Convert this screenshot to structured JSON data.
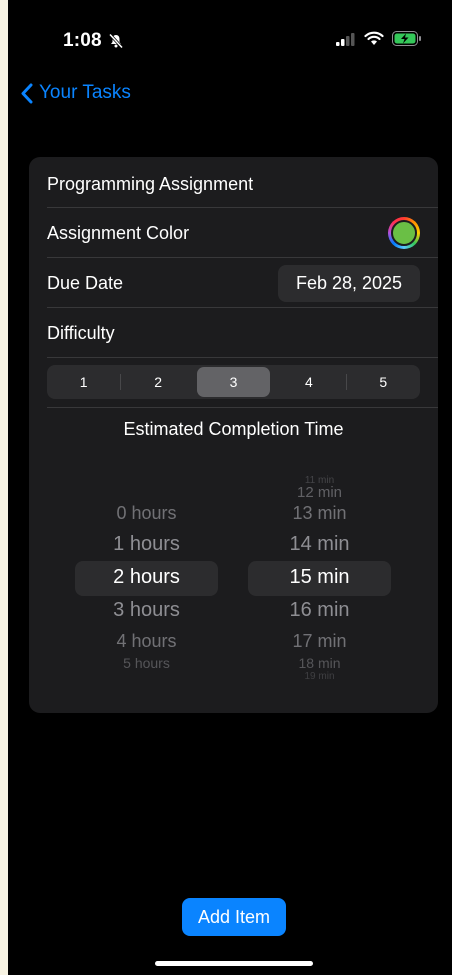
{
  "status": {
    "time": "1:08"
  },
  "nav": {
    "back_label": "Your Tasks"
  },
  "form": {
    "name_value": "Programming Assignment",
    "color_label": "Assignment Color",
    "color_value": "#6abf45",
    "due_label": "Due Date",
    "due_value": "Feb 28, 2025",
    "difficulty_label": "Difficulty",
    "difficulty_options": [
      "1",
      "2",
      "3",
      "4",
      "5"
    ],
    "difficulty_selected": "3",
    "estimate_title": "Estimated Completion Time"
  },
  "picker": {
    "hours": [
      "0 hours",
      "1 hours",
      "2 hours",
      "3 hours",
      "4 hours",
      "5 hours"
    ],
    "hours_selected": "2 hours",
    "minutes": [
      "11 min",
      "12 min",
      "13 min",
      "14 min",
      "15 min",
      "16 min",
      "17 min",
      "18 min",
      "19 min"
    ],
    "minutes_selected": "15 min"
  },
  "actions": {
    "add_label": "Add Item"
  },
  "colors": {
    "accent": "#0a84ff",
    "card": "#1c1c1e",
    "background": "#000000"
  }
}
